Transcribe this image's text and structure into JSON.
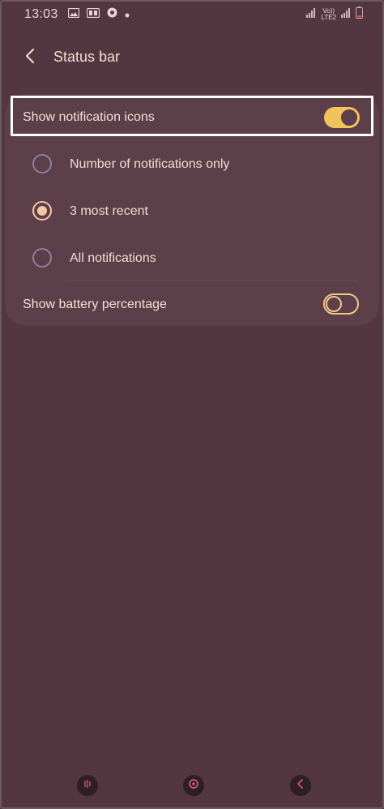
{
  "status_bar": {
    "time": "13:03",
    "network_label_top": "Vo))",
    "network_label_bottom": "LTE2",
    "icons": [
      "image-icon",
      "cast-icon",
      "chrome-icon",
      "dot-icon",
      "signal-icon",
      "signal-icon",
      "battery-icon"
    ]
  },
  "header": {
    "title": "Status bar",
    "back_icon": "back-arrow-icon"
  },
  "settings": {
    "show_notification_icons": {
      "label": "Show notification icons",
      "enabled": true
    },
    "options": [
      {
        "label": "Number of notifications only",
        "selected": false
      },
      {
        "label": "3 most recent",
        "selected": true
      },
      {
        "label": "All notifications",
        "selected": false
      }
    ],
    "show_battery_percentage": {
      "label": "Show battery percentage",
      "enabled": false
    }
  },
  "navigation": {
    "buttons": [
      "recents-icon",
      "home-icon",
      "back-icon"
    ]
  },
  "colors": {
    "background": "#53363f",
    "card": "#5d3f4a",
    "accent": "#f2c35c",
    "text": "#f4e0d2"
  }
}
